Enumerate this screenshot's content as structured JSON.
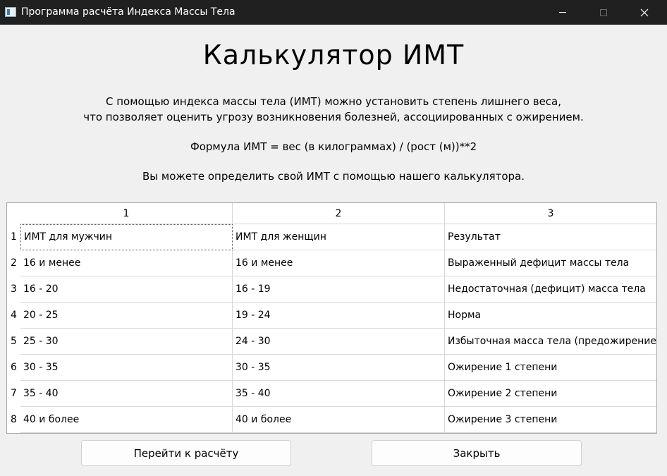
{
  "window": {
    "title": "Программа расчёта Индекса Массы Тела",
    "icon": "app-window-icon",
    "controls": {
      "minimize": "minimize-icon",
      "maximize": "maximize-icon",
      "close": "close-icon"
    }
  },
  "main": {
    "heading": "Калькулятор ИМТ",
    "description_line1": "С помощью индекса массы тела (ИМТ) можно установить степень лишнего веса,",
    "description_line2": "что позволяет оценить угрозу возникновения болезней, ассоциированных с ожирением.",
    "formula": "Формула ИМТ = вес (в килограммах) / (рост (м))**2",
    "call_to_action": "Вы можете определить свой ИМТ с помощью нашего калькулятора."
  },
  "table": {
    "columns": [
      "1",
      "2",
      "3"
    ],
    "rows": [
      {
        "header": "1",
        "cells": [
          "ИМТ для мужчин",
          "ИМТ для женщин",
          "Результат"
        ]
      },
      {
        "header": "2",
        "cells": [
          "16 и менее",
          "16 и менее",
          "Выраженный дефицит массы тела"
        ]
      },
      {
        "header": "3",
        "cells": [
          "16 - 20",
          "16 - 19",
          "Недостаточная (дефицит) масса тела"
        ]
      },
      {
        "header": "4",
        "cells": [
          "20 - 25",
          "19 - 24",
          "Норма"
        ]
      },
      {
        "header": "5",
        "cells": [
          "25 - 30",
          "24 - 30",
          "Избыточная масса тела (предожирение)"
        ]
      },
      {
        "header": "6",
        "cells": [
          "30 - 35",
          "30 - 35",
          "Ожирение 1 степени"
        ]
      },
      {
        "header": "7",
        "cells": [
          "35 - 40",
          "35 - 40",
          "Ожирение 2 степени"
        ]
      },
      {
        "header": "8",
        "cells": [
          "40 и более",
          "40 и более",
          "Ожирение 3 степени"
        ]
      }
    ]
  },
  "buttons": {
    "calculate": "Перейти к расчёту",
    "close": "Закрыть"
  },
  "colors": {
    "titlebar_bg": "#202020",
    "window_bg": "#f0f0f0",
    "table_bg": "#ffffff",
    "grid": "#d8d8d8"
  }
}
